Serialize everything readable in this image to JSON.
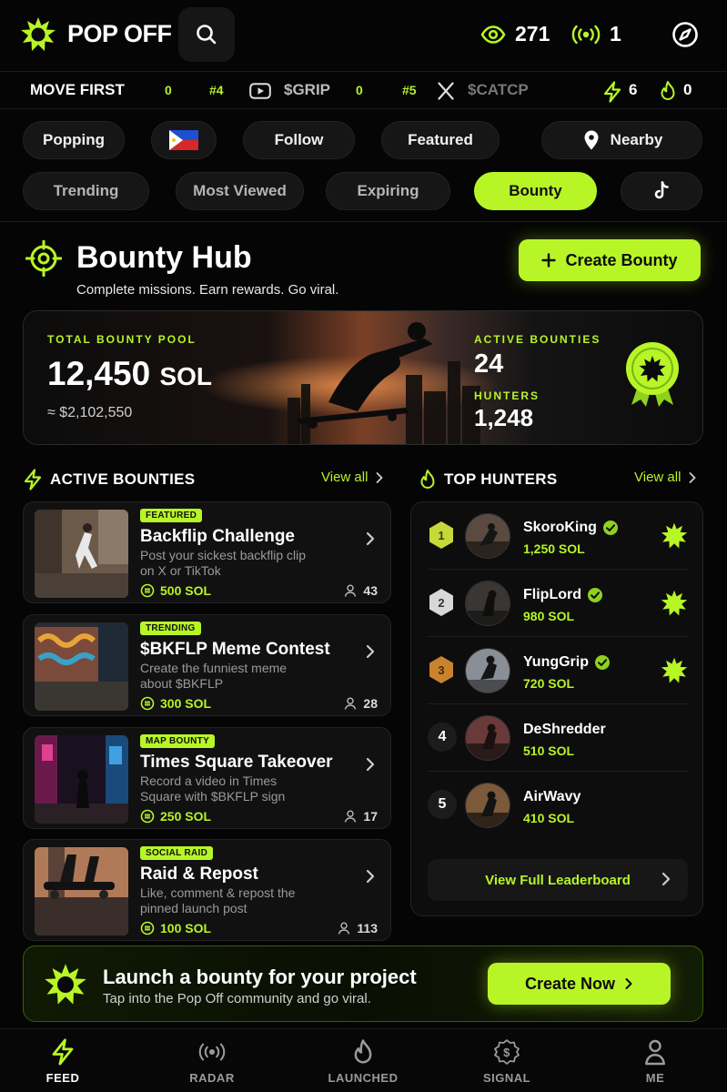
{
  "header": {
    "brand": "POP OFF",
    "views": "271",
    "live": "1",
    "colors": {
      "accent": "#b8f526",
      "background": "#050505"
    }
  },
  "ticker": {
    "label": "MOVE FIRST",
    "items": [
      {
        "val": "0"
      },
      {
        "rank": "#4",
        "icon": "youtube-icon",
        "token": "$GRIP"
      },
      {
        "val": "0"
      },
      {
        "rank": "#5",
        "icon": "x-icon",
        "token": "$CATCP"
      }
    ],
    "bolt_count": "6",
    "flame_count": "0"
  },
  "filters": {
    "row1": [
      "Popping",
      "",
      "Follow",
      "Featured",
      "Nearby"
    ],
    "row2": [
      "Trending",
      "Most Viewed",
      "Expiring",
      "Bounty",
      ""
    ],
    "flag_icon": "philippines-flag-icon",
    "active": "Bounty"
  },
  "hub": {
    "title": "Bounty Hub",
    "subtitle": "Complete missions. Earn rewards. Go viral.",
    "create_label": "Create Bounty"
  },
  "pool": {
    "label": "TOTAL BOUNTY POOL",
    "amount": "12,450",
    "unit": "SOL",
    "usd": "≈ $2,102,550",
    "active_label": "ACTIVE BOUNTIES",
    "active_value": "24",
    "hunters_label": "HUNTERS",
    "hunters_value": "1,248"
  },
  "active_bounties": {
    "title": "ACTIVE BOUNTIES",
    "view_all": "View all",
    "items": [
      {
        "tag": "FEATURED",
        "title": "Backflip Challenge",
        "desc": "Post your sickest backflip clip on X or TikTok",
        "reward": "500 SOL",
        "count": "43"
      },
      {
        "tag": "TRENDING",
        "title": "$BKFLP Meme Contest",
        "desc": "Create the funniest meme about $BKFLP",
        "reward": "300 SOL",
        "count": "28"
      },
      {
        "tag": "MAP BOUNTY",
        "title": "Times Square Takeover",
        "desc": "Record a video in Times Square with $BKFLP sign",
        "reward": "250 SOL",
        "count": "17"
      },
      {
        "tag": "SOCIAL RAID",
        "title": "Raid & Repost",
        "desc": "Like, comment & repost the pinned launch post",
        "reward": "100 SOL",
        "count": "113"
      }
    ]
  },
  "top_hunters": {
    "title": "TOP HUNTERS",
    "view_all": "View all",
    "items": [
      {
        "rank": "1",
        "name": "SkoroKing",
        "sol": "1,250 SOL",
        "verified": true
      },
      {
        "rank": "2",
        "name": "FlipLord",
        "sol": "980 SOL",
        "verified": true
      },
      {
        "rank": "3",
        "name": "YungGrip",
        "sol": "720 SOL",
        "verified": true
      },
      {
        "rank": "4",
        "name": "DeShredder",
        "sol": "510 SOL",
        "verified": false
      },
      {
        "rank": "5",
        "name": "AirWavy",
        "sol": "410 SOL",
        "verified": false
      }
    ],
    "leaderboard_label": "View Full Leaderboard"
  },
  "cta": {
    "title": "Launch a bounty for your project",
    "subtitle": "Tap into the Pop Off community and go viral.",
    "button": "Create Now"
  },
  "nav": [
    "FEED",
    "RADAR",
    "LAUNCHED",
    "SIGNAL",
    "ME"
  ]
}
